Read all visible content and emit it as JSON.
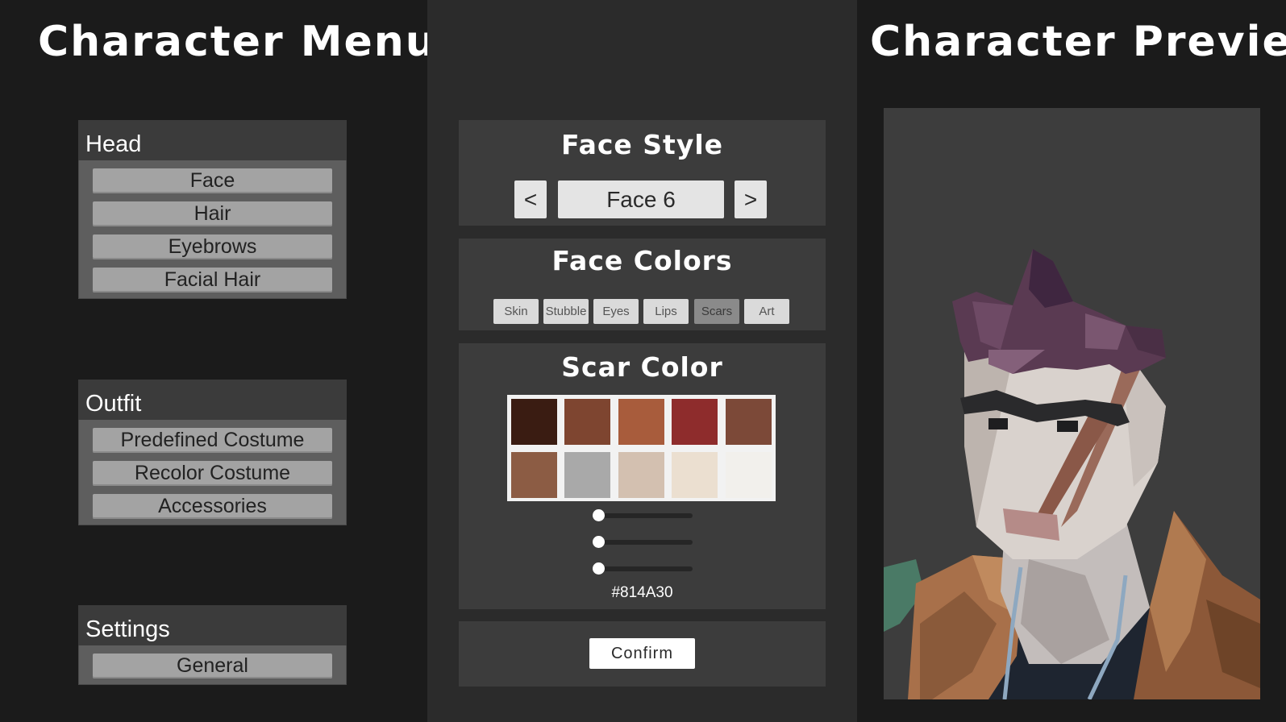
{
  "left": {
    "title": "Character Menu",
    "groups": [
      {
        "header": "Head",
        "items": [
          "Face",
          "Hair",
          "Eyebrows",
          "Facial Hair"
        ]
      },
      {
        "header": "Outfit",
        "items": [
          "Predefined Costume",
          "Recolor Costume",
          "Accessories"
        ]
      },
      {
        "header": "Settings",
        "items": [
          "General"
        ]
      }
    ]
  },
  "face_style": {
    "title": "Face Style",
    "prev_label": "<",
    "value": "Face 6",
    "next_label": ">"
  },
  "face_colors": {
    "title": "Face Colors",
    "tabs": [
      "Skin",
      "Stubble",
      "Eyes",
      "Lips",
      "Scars",
      "Art"
    ],
    "active_tab": "Scars"
  },
  "scar_color": {
    "title": "Scar Color",
    "swatches": [
      "#3a1c12",
      "#7e4530",
      "#a85c3c",
      "#8e2c2c",
      "#7c4938",
      "#8c5c44",
      "#a9a9a9",
      "#d3c0b0",
      "#ebdfd0",
      "#f2f0ec"
    ],
    "slider_values": [
      0,
      0,
      0
    ],
    "hex_value": "#814A30"
  },
  "confirm_label": "Confirm",
  "right": {
    "title": "Character Preview"
  },
  "colors": {
    "panel_bg": "#3c3c3c",
    "menu_header_bg": "#3b3b3b",
    "menu_button": "#a3a3a3",
    "active_tab": "#8a8a8a"
  }
}
